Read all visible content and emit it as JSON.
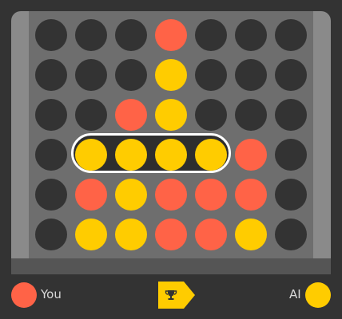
{
  "colors": {
    "background": "#333333",
    "empty": "#333333",
    "red": "#ff6347",
    "yellow": "#ffcc00",
    "highlight": "#ffffff"
  },
  "board": {
    "rows": [
      [
        "empty",
        "empty",
        "empty",
        "red",
        "empty",
        "empty",
        "empty"
      ],
      [
        "empty",
        "empty",
        "empty",
        "yellow",
        "empty",
        "empty",
        "empty"
      ],
      [
        "empty",
        "empty",
        "red",
        "yellow",
        "empty",
        "empty",
        "empty"
      ],
      [
        "empty",
        "yellow",
        "yellow",
        "yellow",
        "yellow",
        "red",
        "empty"
      ],
      [
        "empty",
        "red",
        "yellow",
        "red",
        "red",
        "red",
        "empty"
      ],
      [
        "empty",
        "yellow",
        "yellow",
        "red",
        "red",
        "yellow",
        "empty"
      ]
    ],
    "winning_line": {
      "row": 3,
      "from_col": 1,
      "to_col": 4
    }
  },
  "footer": {
    "player": {
      "label": "You",
      "color": "red"
    },
    "opponent": {
      "label": "AI",
      "color": "yellow"
    },
    "result_icon": "trophy-icon"
  }
}
